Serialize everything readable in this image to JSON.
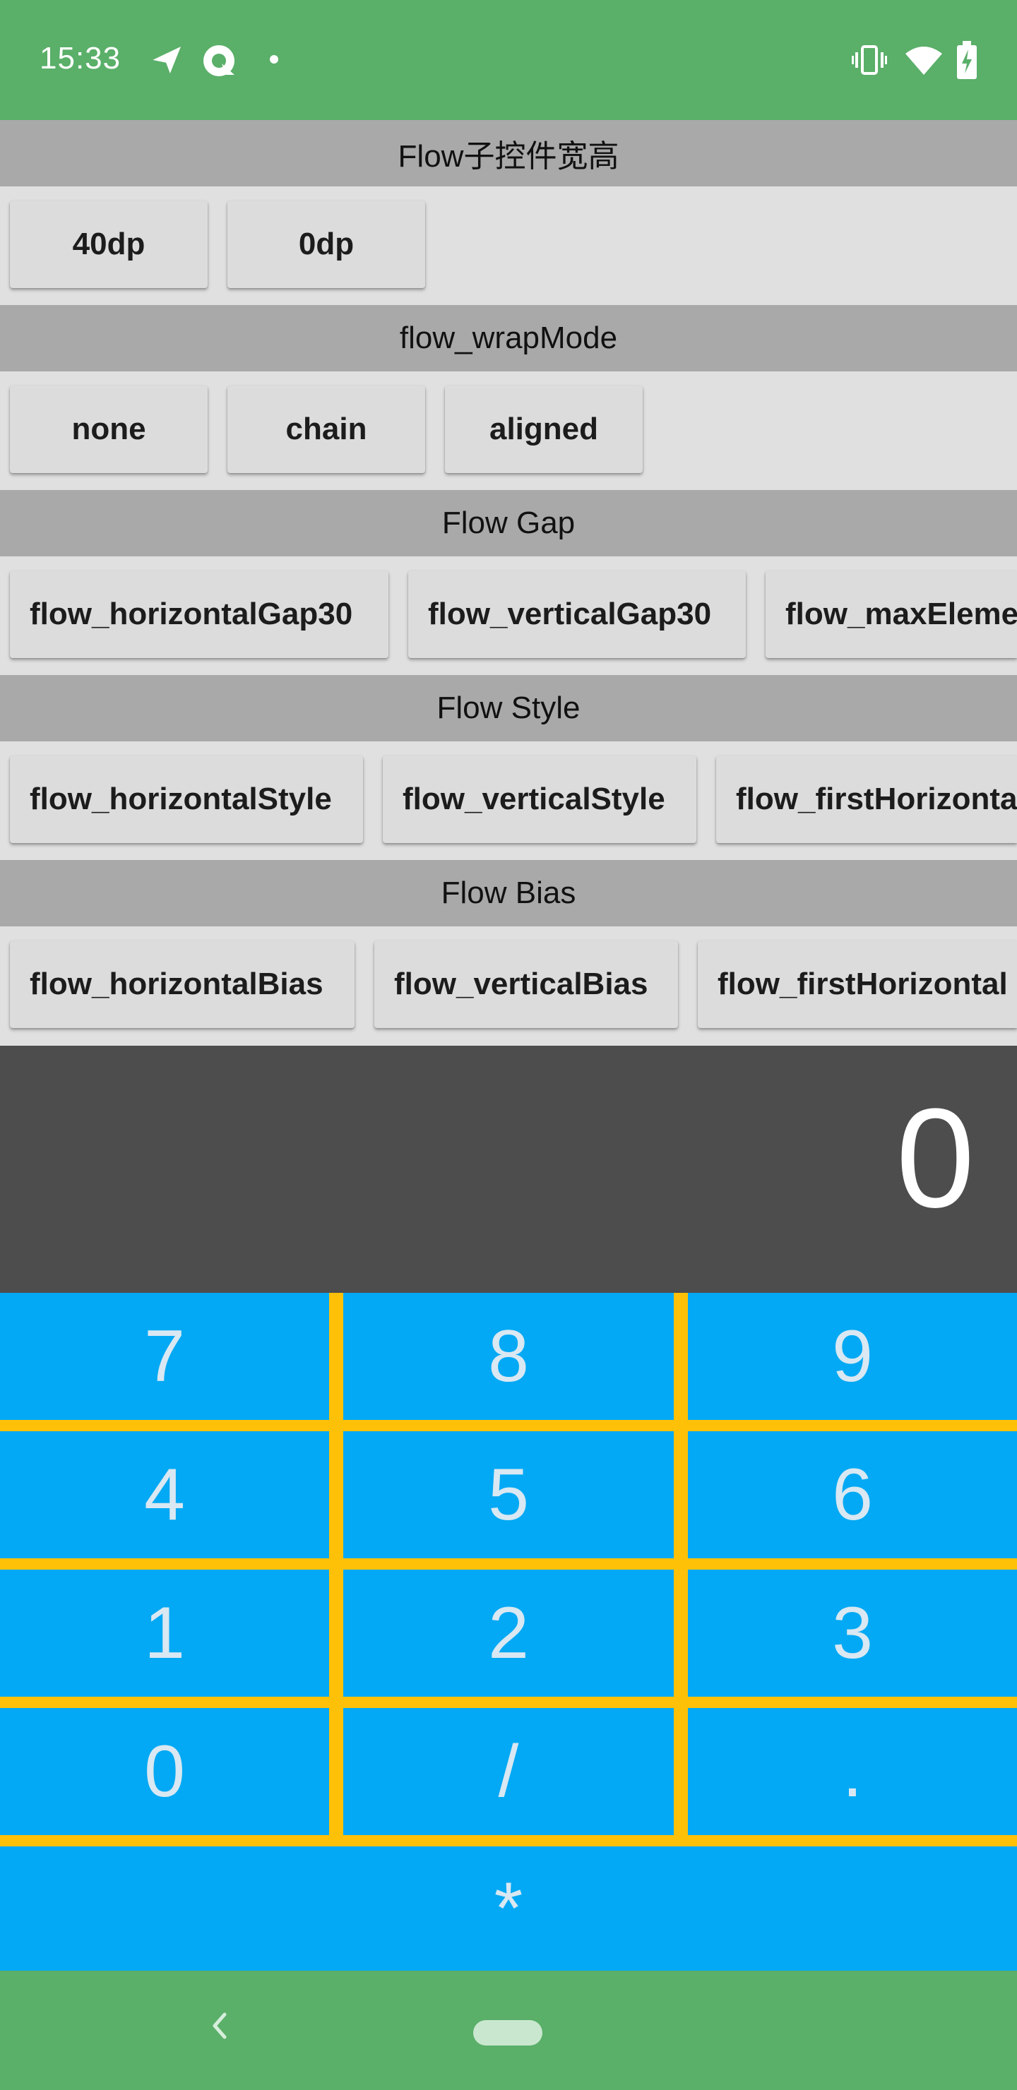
{
  "status_bar": {
    "time": "15:33",
    "left_icons": [
      "flight-icon",
      "messenger-icon",
      "dot-icon"
    ],
    "right_icons": [
      "vibrate-icon",
      "wifi-icon",
      "battery-charging-icon"
    ],
    "color": "#5aaf69"
  },
  "sections": [
    {
      "title": "Flow子控件宽高",
      "buttons": [
        "40dp",
        "0dp"
      ]
    },
    {
      "title": "flow_wrapMode",
      "buttons": [
        "none",
        "chain",
        "aligned"
      ]
    },
    {
      "title": "Flow Gap",
      "buttons": [
        "flow_horizontalGap30",
        "flow_verticalGap30",
        "flow_maxEleme"
      ]
    },
    {
      "title": "Flow Style",
      "buttons": [
        "flow_horizontalStyle",
        "flow_verticalStyle",
        "flow_firstHorizonta"
      ]
    },
    {
      "title": "Flow Bias",
      "buttons": [
        "flow_horizontalBias",
        "flow_verticalBias",
        "flow_firstHorizontal"
      ]
    }
  ],
  "calculator": {
    "display_value": "0",
    "keys": [
      [
        "7",
        "8",
        "9"
      ],
      [
        "4",
        "5",
        "6"
      ],
      [
        "1",
        "2",
        "3"
      ],
      [
        "0",
        "/",
        "."
      ],
      [
        "*"
      ]
    ],
    "key_color": "#03a9f4",
    "divider_color": "#ffc107",
    "display_color": "#4d4d4d"
  },
  "nav_bar": {
    "icons": [
      "back-icon",
      "home-pill-icon"
    ],
    "color": "#5aaf69"
  }
}
